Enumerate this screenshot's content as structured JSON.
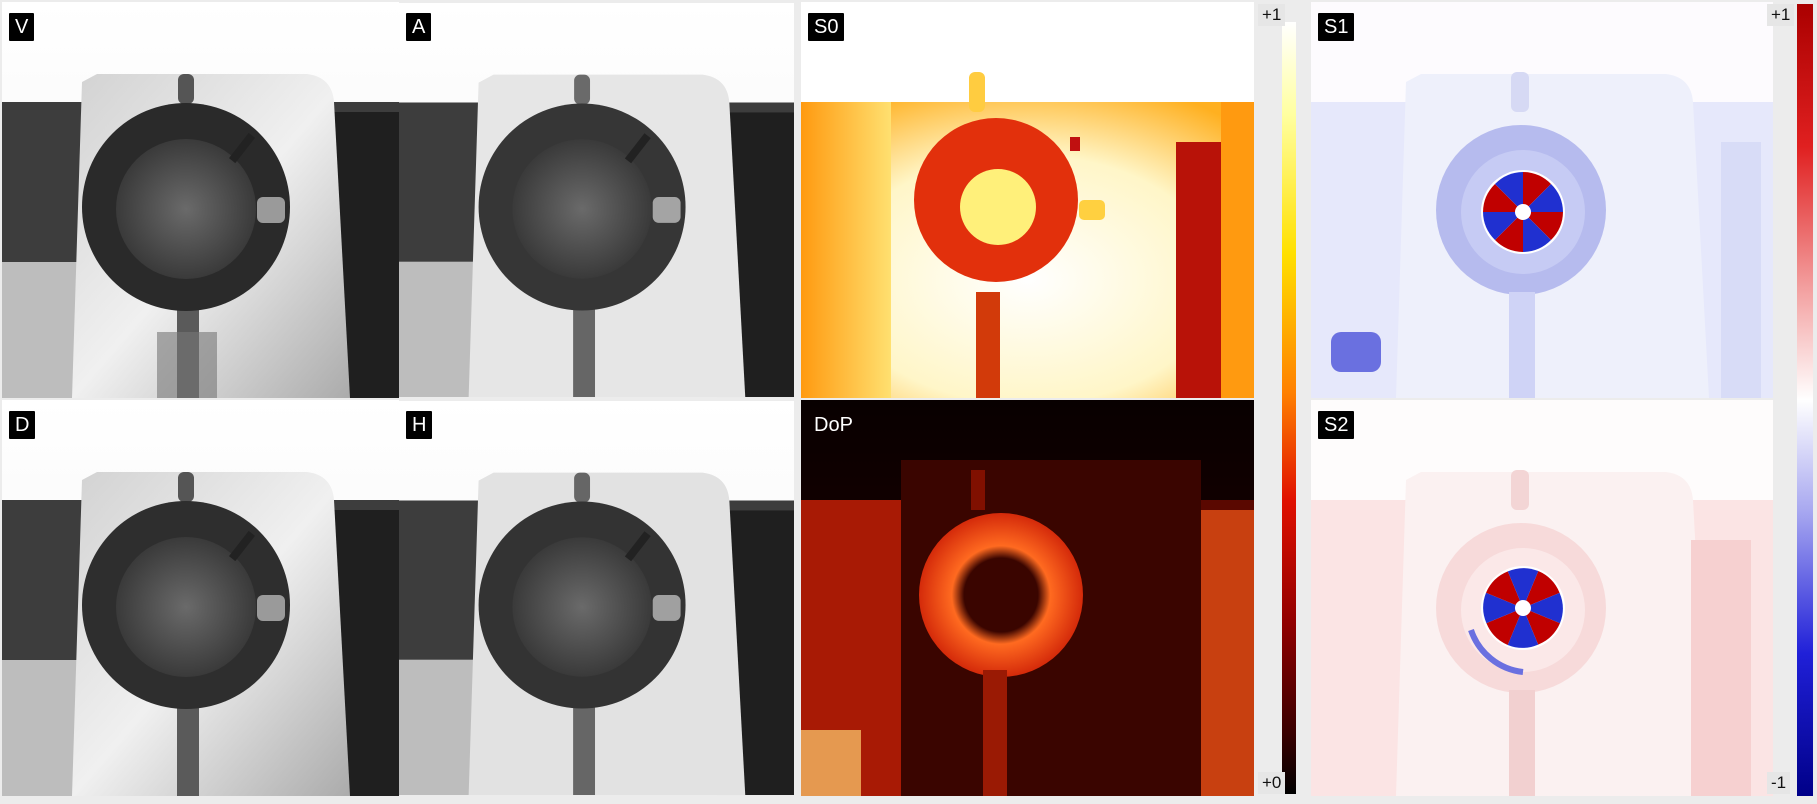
{
  "panels": {
    "v": {
      "label": "V"
    },
    "a": {
      "label": "A"
    },
    "d": {
      "label": "D"
    },
    "h": {
      "label": "H"
    },
    "s0": {
      "label": "S0"
    },
    "dop": {
      "label": "DoP"
    },
    "s1": {
      "label": "S1"
    },
    "s2": {
      "label": "S2"
    }
  },
  "colorbars": {
    "intensity": {
      "top_label": "+1",
      "bottom_label": "+0",
      "colormap": "hot"
    },
    "stokes": {
      "top_label": "+1",
      "bottom_label": "-1",
      "colormap": "blue-white-red"
    }
  },
  "colors": {
    "hot_dark": "#1a0000",
    "hot_red": "#d42a0a",
    "hot_yellow": "#ffd24a",
    "diverging_red": "#cc0000",
    "diverging_blue": "#0000cc"
  }
}
